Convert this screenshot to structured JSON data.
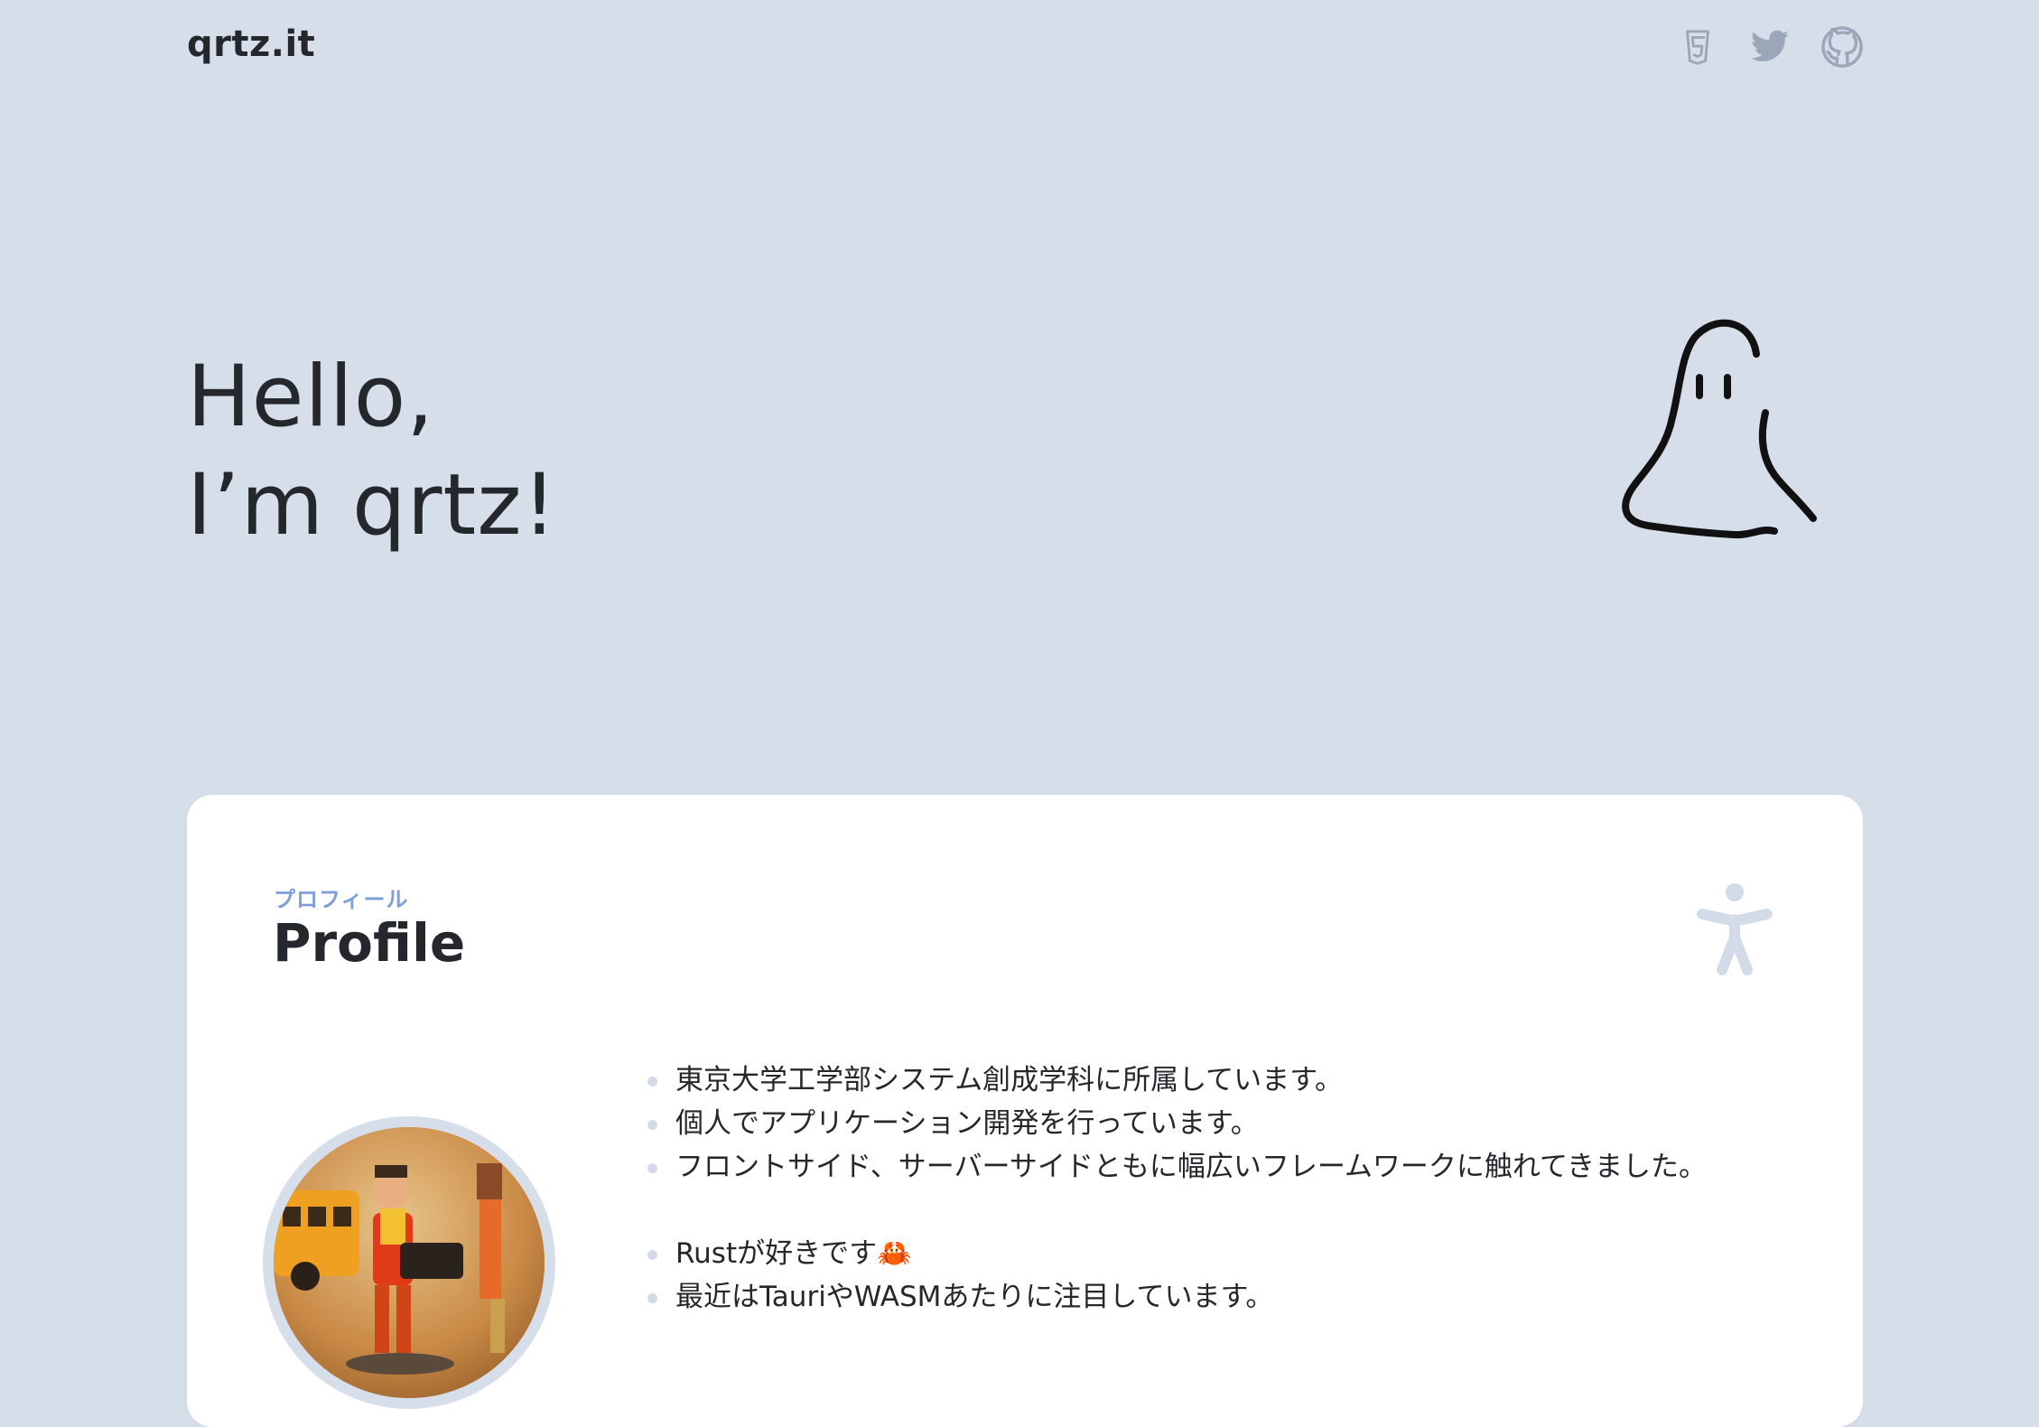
{
  "header": {
    "logo": "qrtz.it",
    "social": [
      {
        "name": "html5-icon"
      },
      {
        "name": "twitter-icon"
      },
      {
        "name": "github-icon"
      }
    ]
  },
  "hero": {
    "line1": "Hello,",
    "line2": "I’m qrtz!"
  },
  "profile": {
    "subtitle": "プロフィール",
    "title": "Profile",
    "icon": "accessibility-icon",
    "facts_group1": [
      "東京大学工学部システム創成学科に所属しています。",
      "個人でアプリケーション開発を行っています。",
      "フロントサイド、サーバーサイドともに幅広いフレームワークに触れてきました。"
    ],
    "facts_group2": [
      "Rustが好きです🦀",
      "最近はTauriやWASMあたりに注目しています。"
    ]
  },
  "colors": {
    "background": "#d6deea",
    "card": "#ffffff",
    "accent": "#7d9ed6",
    "text": "#24272c"
  }
}
